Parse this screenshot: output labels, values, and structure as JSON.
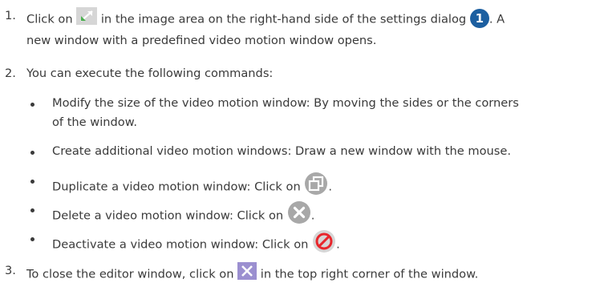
{
  "steps": [
    {
      "num": "1.",
      "a": "Click on",
      "b": "in the image area on the right-hand side of the settings dialog",
      "badge": "1",
      "c": ". A",
      "d": "new window with a predefined video motion window opens."
    },
    {
      "num": "2.",
      "text": "You can execute the following commands:",
      "bullets": [
        {
          "l1": "Modify the size of the video motion window: By moving the sides or the corners",
          "l2": "of the window."
        },
        {
          "text": "Create additional video motion windows: Draw a new window with the mouse."
        },
        {
          "text": "Duplicate a video motion window: Click on",
          "tail": ".",
          "icon": "duplicate-icon"
        },
        {
          "text": "Delete a video motion window: Click on",
          "tail": ".",
          "icon": "delete-icon"
        },
        {
          "text": "Deactivate a video motion window: Click on",
          "tail": ".",
          "icon": "deactivate-icon"
        }
      ]
    },
    {
      "num": "3.",
      "a": "To close the editor window, click on",
      "b": "in the top right corner of the window."
    }
  ],
  "colors": {
    "badge": "#1c5fa0",
    "icon_gray": "#a8a8a8",
    "close_purple": "#9b8fd0",
    "deactivate_red": "#e8262c",
    "expand_green": "#4caf50"
  }
}
